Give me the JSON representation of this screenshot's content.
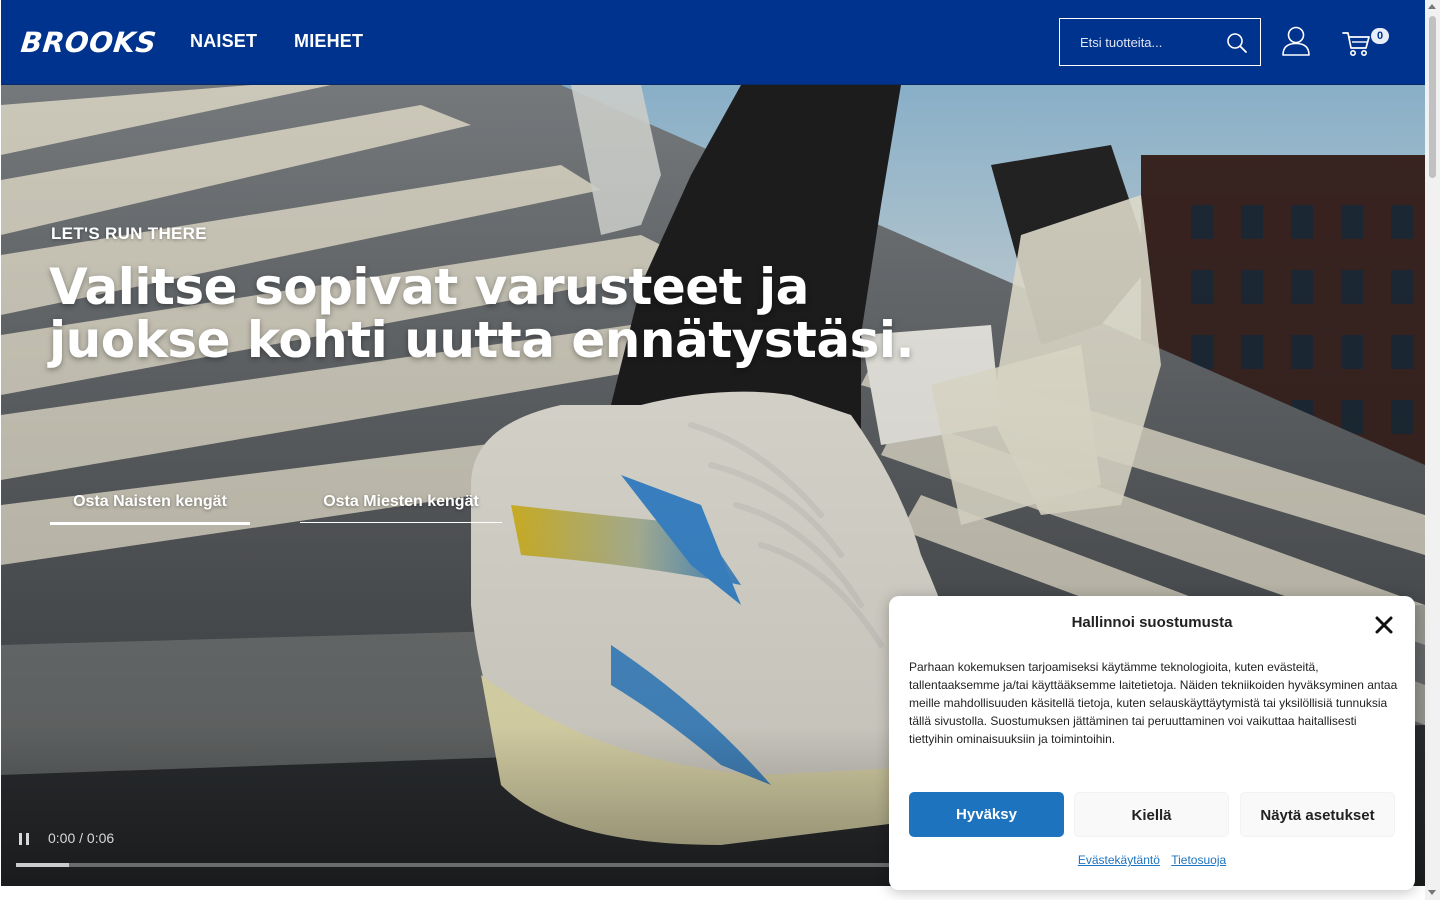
{
  "header": {
    "logo": "BROOKS",
    "nav": [
      {
        "label": "NAISET"
      },
      {
        "label": "MIEHET"
      }
    ],
    "search_placeholder": "Etsi tuotteita...",
    "cart_count": "0",
    "background_color": "#00338d"
  },
  "hero": {
    "eyebrow": "LET'S RUN THERE",
    "title": "Valitse sopivat varusteet ja juokse kohti uutta ennätystäsi.",
    "cta_women": "Osta Naisten kengät",
    "cta_men": "Osta Miesten kengät",
    "video": {
      "time": "0:00 / 0:06",
      "progress": 0.06
    }
  },
  "cookie_banner": {
    "title": "Hallinnoi suostumusta",
    "body": "Parhaan kokemuksen tarjoamiseksi käytämme teknologioita, kuten evästeitä, tallentaaksemme ja/tai käyttääksemme laitetietoja. Näiden tekniikoiden hyväksyminen antaa meille mahdollisuuden käsitellä tietoja, kuten selauskäyttäytymistä tai yksilöllisiä tunnuksia tällä sivustolla. Suostumuksen jättäminen tai peruuttaminen voi vaikuttaa haitallisesti tiettyihin ominaisuuksiin ja toimintoihin.",
    "accept_label": "Hyväksy",
    "deny_label": "Kiellä",
    "settings_label": "Näytä asetukset",
    "links": [
      {
        "label": "Evästekäytäntö"
      },
      {
        "label": "Tietosuoja"
      }
    ],
    "accent_color": "#1e73be"
  }
}
